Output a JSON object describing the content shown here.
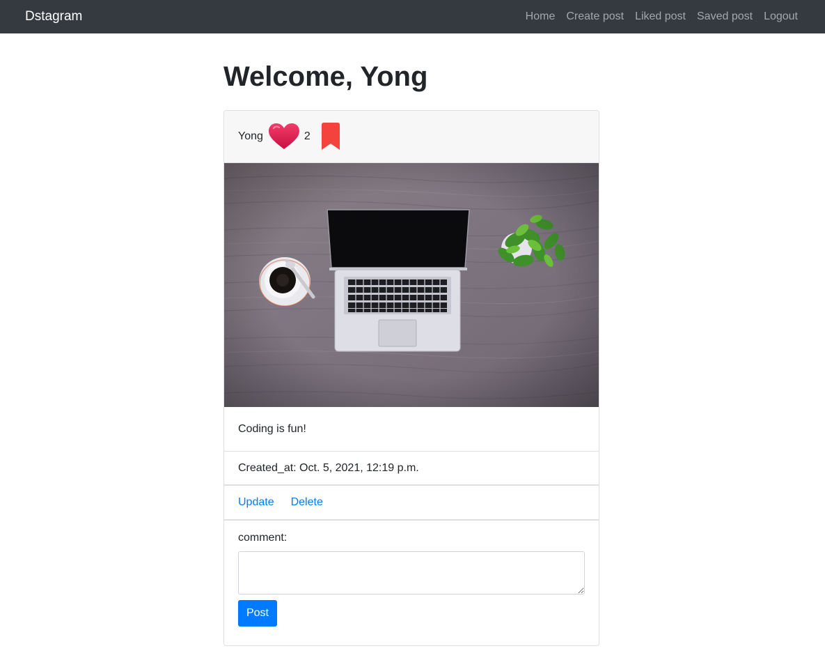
{
  "navbar": {
    "brand": "Dstagram",
    "links": [
      "Home",
      "Create post",
      "Liked post",
      "Saved post",
      "Logout"
    ]
  },
  "page": {
    "welcome": "Welcome, Yong"
  },
  "post": {
    "author": "Yong",
    "like_count": "2",
    "caption": "Coding is fun!",
    "created_at": "Created_at: Oct. 5, 2021, 12:19 p.m.",
    "actions": {
      "update": "Update",
      "delete": "Delete"
    },
    "comment_label": "comment:",
    "post_button": "Post",
    "icons": {
      "like": "heart-icon",
      "save": "bookmark-icon"
    }
  },
  "colors": {
    "navbar": "#343a40",
    "link": "#007bff",
    "heart": "#e8245a",
    "bookmark": "#f4433c"
  }
}
